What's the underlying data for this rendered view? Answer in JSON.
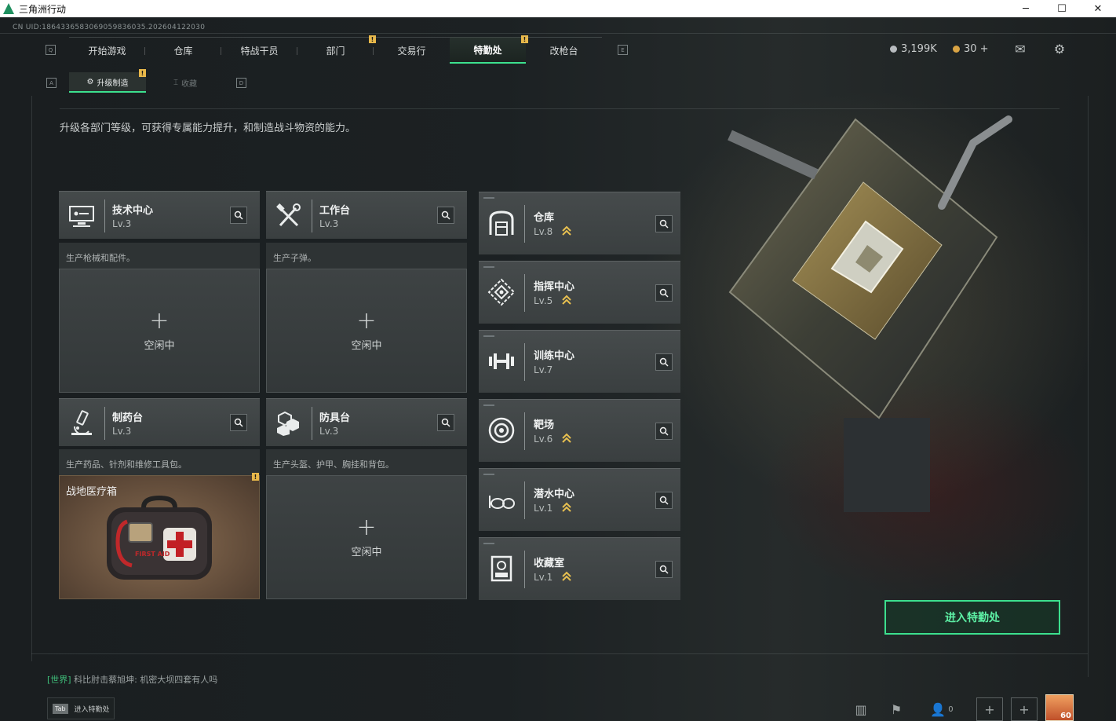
{
  "window": {
    "title": "三角洲行动"
  },
  "uid": "CN UID:1864336583069059836035.202604122030",
  "nav": {
    "tabs": [
      {
        "label": "开始游戏",
        "badge": false,
        "active": false
      },
      {
        "label": "仓库",
        "badge": false,
        "active": false
      },
      {
        "label": "特战干员",
        "badge": false,
        "active": false
      },
      {
        "label": "部门",
        "badge": true,
        "active": false
      },
      {
        "label": "交易行",
        "badge": false,
        "active": false
      },
      {
        "label": "特勤处",
        "badge": true,
        "active": true
      },
      {
        "label": "改枪台",
        "badge": false,
        "active": false
      }
    ],
    "key_left": "Q",
    "key_right": "E"
  },
  "currency": {
    "silver": "3,199K",
    "gold": "30 +"
  },
  "subtabs": {
    "key_left": "A",
    "key_right": "D",
    "active": "升级制造",
    "inactive": "收藏"
  },
  "badge_text": "!",
  "description": "升级各部门等级，可获得专属能力提升，和制造战斗物资的能力。",
  "workstations": [
    {
      "name": "技术中心",
      "level": "Lv.3",
      "desc": "生产枪械和配件。",
      "icon": "computer-icon",
      "status": "空闲中",
      "crafting": null
    },
    {
      "name": "工作台",
      "level": "Lv.3",
      "desc": "生产子弹。",
      "icon": "tools-icon",
      "status": "空闲中",
      "crafting": null
    },
    {
      "name": "制药台",
      "level": "Lv.3",
      "desc": "生产药品、针剂和维修工具包。",
      "icon": "microscope-icon",
      "status": "",
      "crafting": "战地医疗箱"
    },
    {
      "name": "防具台",
      "level": "Lv.3",
      "desc": "生产头盔、护甲、胸挂和背包。",
      "icon": "armor-blocks-icon",
      "status": "空闲中",
      "crafting": null
    }
  ],
  "medkit_label": "FIRST AID",
  "departments": [
    {
      "name": "仓库",
      "level": "Lv.8",
      "upgradable": true,
      "icon": "warehouse-icon"
    },
    {
      "name": "指挥中心",
      "level": "Lv.5",
      "upgradable": true,
      "icon": "command-icon"
    },
    {
      "name": "训练中心",
      "level": "Lv.7",
      "upgradable": false,
      "icon": "dumbbell-icon"
    },
    {
      "name": "靶场",
      "level": "Lv.6",
      "upgradable": true,
      "icon": "target-icon"
    },
    {
      "name": "潜水中心",
      "level": "Lv.1",
      "upgradable": true,
      "icon": "goggles-icon"
    },
    {
      "name": "收藏室",
      "level": "Lv.1",
      "upgradable": true,
      "icon": "collection-icon"
    }
  ],
  "enter_button": "进入特勤处",
  "chat": {
    "channel": "[世界]",
    "sender": "科比肘击蔡旭坤:",
    "message": "机密大坝四套有人吗"
  },
  "tab_hint": {
    "key": "Tab",
    "label": "进入特勤处"
  },
  "friends_count": "0",
  "player_level": "60",
  "colors": {
    "accent": "#3ce08e",
    "badge": "#e8b84a",
    "upgrade": "#e8c050"
  }
}
